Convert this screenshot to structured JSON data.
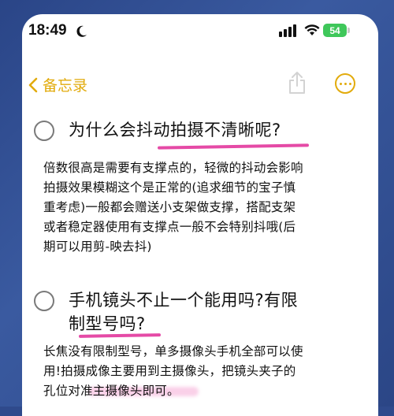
{
  "status": {
    "time": "18:49",
    "battery": "54"
  },
  "nav": {
    "back_label": "备忘录"
  },
  "colors": {
    "accent": "#e2ab0c",
    "highlight": "#e54aa6",
    "background": "#2f4a8c"
  },
  "icons": [
    "moon-icon",
    "signal-icon",
    "wifi-icon",
    "battery-icon",
    "chevron-left-icon",
    "share-icon",
    "more-icon",
    "checkbox-icon"
  ],
  "notes": [
    {
      "heading": "为什么会抖动拍摄不清晰呢?",
      "body": [
        "倍数很高是需要有支撑点的，轻微的抖动会影响",
        "拍摄效果模糊这个是正常的(追求细节的宝子慎",
        "重考虑)一般都会赠送小支架做支撑，搭配支架",
        "或者稳定器使用有支撑点一般不会特别抖哦(后",
        "期可以用剪-映去抖)"
      ]
    },
    {
      "heading_line1": "手机镜头不止一个能用吗?有限",
      "heading_line2": "制型号吗?",
      "body": [
        "长焦没有限制型号，单多摄像头手机全部可以使",
        "用!拍摄成像主要用到主摄像头，把镜头夹子的",
        "孔位对准主摄像头即可。"
      ]
    }
  ]
}
